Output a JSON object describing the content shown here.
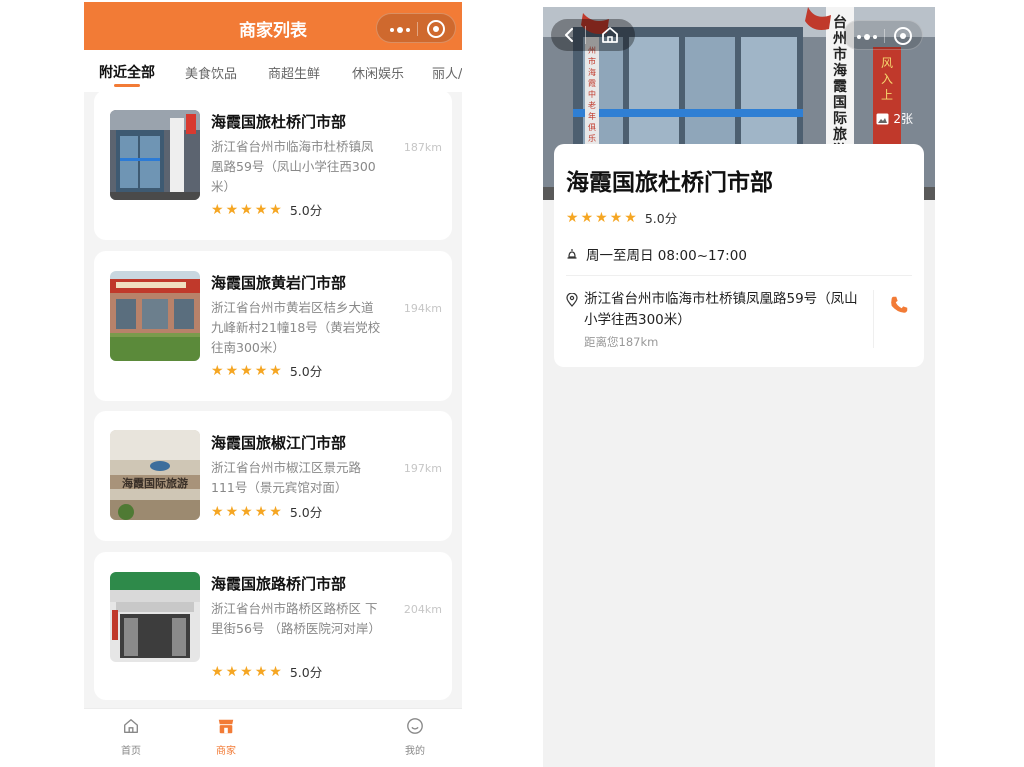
{
  "list_screen": {
    "title": "商家列表",
    "categories": [
      "附近全部",
      "美食饮品",
      "商超生鲜",
      "休闲娱乐",
      "丽人/"
    ],
    "active_category": "附近全部",
    "stores": [
      {
        "name": "海霞国旅杜桥门市部",
        "address": "浙江省台州市临海市杜桥镇凤凰路59号（凤山小学往西300米）",
        "distance": "187km",
        "score": "5.0分",
        "rating": 5
      },
      {
        "name": "海霞国旅黄岩门市部",
        "address": "浙江省台州市黄岩区桔乡大道九峰新村21幢18号（黄岩党校往南300米）",
        "distance": "194km",
        "score": "5.0分",
        "rating": 5
      },
      {
        "name": "海霞国旅椒江门市部",
        "address": "浙江省台州市椒江区景元路111号（景元宾馆对面）",
        "distance": "197km",
        "score": "5.0分",
        "rating": 5
      },
      {
        "name": "海霞国旅路桥门市部",
        "address": "浙江省台州市路桥区路桥区 下里街56号 （路桥医院河对岸）",
        "distance": "204km",
        "score": "5.0分",
        "rating": 5
      }
    ],
    "tabbar": [
      {
        "label": "首页",
        "icon": "home-icon"
      },
      {
        "label": "商家",
        "icon": "shop-icon"
      },
      {
        "label": "我的",
        "icon": "profile-icon"
      }
    ],
    "active_tab": "商家",
    "accent_color": "#f27b36",
    "star_color": "#f5a623"
  },
  "detail_screen": {
    "photo_count": "2张",
    "name": "海霞国旅杜桥门市部",
    "score": "5.0分",
    "rating": 5,
    "hours": "周一至周日 08:00~17:00",
    "address": "浙江省台州市临海市杜桥镇凤凰路59号（凤山小学往西300米）",
    "distance": "距离您187km",
    "hero_signs": {
      "vertical_banner": "台州市海霞国际旅游有",
      "small_banner": "州市海霞中老年俱乐部",
      "red_couplet": "风入上"
    }
  },
  "thumb_signs": {
    "store3_wall": "海霞国际旅游"
  }
}
